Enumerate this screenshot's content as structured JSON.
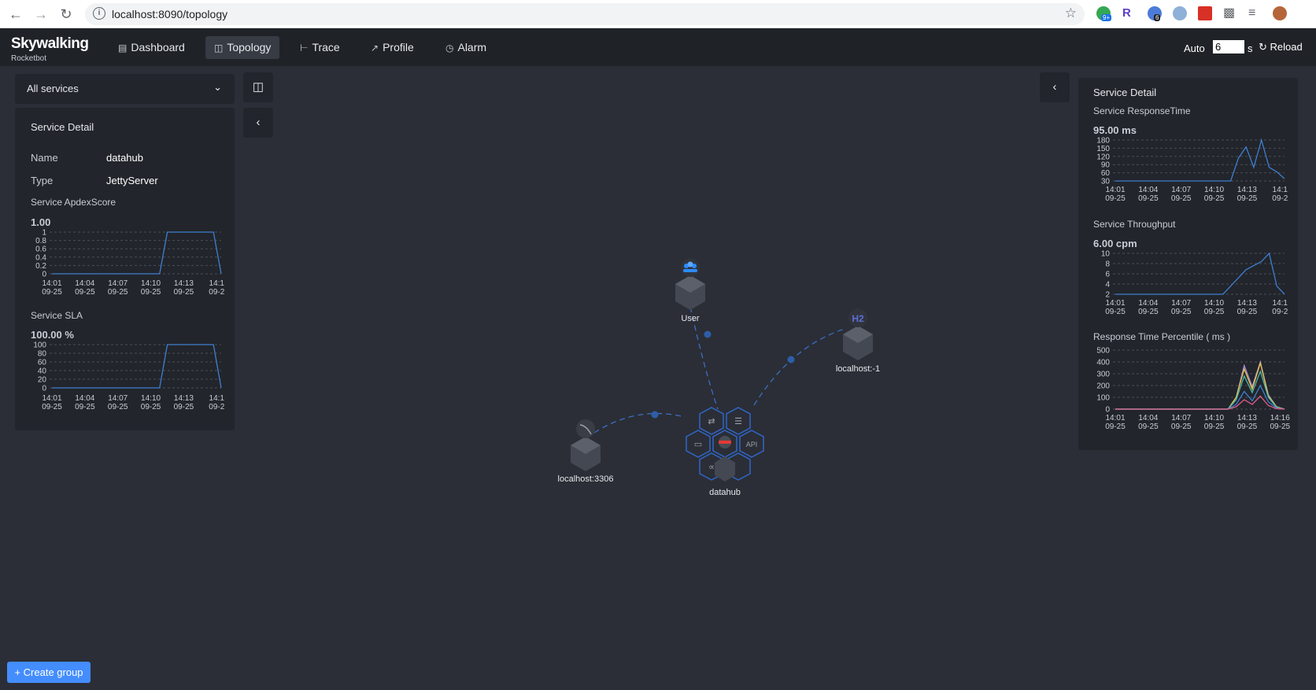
{
  "browser": {
    "url": "localhost:8090/topology",
    "extension_badges": [
      "9+",
      "R",
      "6"
    ]
  },
  "header": {
    "logo": "Skywalking",
    "logo_sub": "Rocketbot",
    "nav": [
      {
        "label": "Dashboard",
        "icon": "dashboard-icon"
      },
      {
        "label": "Topology",
        "icon": "topology-icon",
        "active": true
      },
      {
        "label": "Trace",
        "icon": "trace-icon"
      },
      {
        "label": "Profile",
        "icon": "profile-icon"
      },
      {
        "label": "Alarm",
        "icon": "alarm-icon"
      }
    ],
    "auto_label": "Auto",
    "interval_value": "6",
    "interval_unit": "s",
    "reload_label": "Reload"
  },
  "left": {
    "service_select": "All services",
    "detail_title": "Service Detail",
    "name_key": "Name",
    "name_value": "datahub",
    "type_key": "Type",
    "type_value": "JettyServer",
    "apdex_label": "Service ApdexScore",
    "apdex_value": "1.00",
    "sla_label": "Service SLA",
    "sla_value": "100.00 %"
  },
  "right": {
    "detail_title": "Service Detail",
    "resp_label": "Service ResponseTime",
    "resp_value": "95.00 ms",
    "tput_label": "Service Throughput",
    "tput_value": "6.00 cpm",
    "percentile_label": "Response Time Percentile ( ms )"
  },
  "create_group_label": "Create group",
  "topology": {
    "nodes": [
      {
        "name": "User",
        "icon": "users-icon"
      },
      {
        "name": "localhost:-1",
        "icon": "h2-icon",
        "icon_text": "H2"
      },
      {
        "name": "localhost:3306",
        "icon": "mysql-icon"
      },
      {
        "name": "datahub",
        "icon": "service-cluster-icon"
      }
    ]
  },
  "chart_data": [
    {
      "type": "line",
      "title": "Service ApdexScore",
      "x_labels": [
        "14:01\n09-25",
        "14:04\n09-25",
        "14:07\n09-25",
        "14:10\n09-25",
        "14:13\n09-25",
        "14:1\n09-2"
      ],
      "yticks": [
        "1",
        "0.8",
        "0.6",
        "0.4",
        "0.2",
        "0"
      ],
      "ylim": [
        0,
        1
      ],
      "values": [
        0,
        0,
        0,
        0,
        0,
        0,
        0,
        0,
        0,
        0,
        0,
        0,
        0,
        0,
        0,
        1,
        1,
        1,
        1,
        1,
        1,
        1,
        0
      ],
      "color": "#3f7fd0"
    },
    {
      "type": "line",
      "title": "Service SLA",
      "x_labels": [
        "14:01\n09-25",
        "14:04\n09-25",
        "14:07\n09-25",
        "14:10\n09-25",
        "14:13\n09-25",
        "14:1\n09-2"
      ],
      "yticks": [
        "100",
        "80",
        "60",
        "40",
        "20",
        "0"
      ],
      "ylim": [
        0,
        100
      ],
      "values": [
        0,
        0,
        0,
        0,
        0,
        0,
        0,
        0,
        0,
        0,
        0,
        0,
        0,
        0,
        0,
        100,
        100,
        100,
        100,
        100,
        100,
        100,
        0
      ],
      "color": "#3f7fd0"
    },
    {
      "type": "line",
      "title": "Service ResponseTime",
      "x_labels": [
        "14:01\n09-25",
        "14:04\n09-25",
        "14:07\n09-25",
        "14:10\n09-25",
        "14:13\n09-25",
        "14:1\n09-2"
      ],
      "yticks": [
        "180",
        "150",
        "120",
        "90",
        "60",
        "30"
      ],
      "ylim": [
        0,
        180
      ],
      "values": [
        0,
        0,
        0,
        0,
        0,
        0,
        0,
        0,
        0,
        0,
        0,
        0,
        0,
        0,
        0,
        0,
        100,
        150,
        60,
        180,
        60,
        40,
        10
      ],
      "color": "#3f7fd0"
    },
    {
      "type": "line",
      "title": "Service Throughput",
      "x_labels": [
        "14:01\n09-25",
        "14:04\n09-25",
        "14:07\n09-25",
        "14:10\n09-25",
        "14:13\n09-25",
        "14:1\n09-2"
      ],
      "yticks": [
        "10",
        "8",
        "6",
        "4",
        "2"
      ],
      "ylim": [
        0,
        10
      ],
      "values": [
        0,
        0,
        0,
        0,
        0,
        0,
        0,
        0,
        0,
        0,
        0,
        0,
        0,
        0,
        0,
        2,
        4,
        6,
        7,
        8,
        10,
        2,
        0
      ],
      "color": "#3f7fd0"
    },
    {
      "type": "line",
      "title": "Response Time Percentile ( ms )",
      "x_labels": [
        "14:01\n09-25",
        "14:04\n09-25",
        "14:07\n09-25",
        "14:10\n09-25",
        "14:13\n09-25",
        "14:16\n09-25"
      ],
      "yticks": [
        "500",
        "400",
        "300",
        "200",
        "100",
        "0"
      ],
      "ylim": [
        0,
        500
      ],
      "series": [
        {
          "values": [
            0,
            0,
            0,
            0,
            0,
            0,
            0,
            0,
            0,
            0,
            0,
            0,
            0,
            0,
            0,
            100,
            370,
            190,
            400,
            120,
            20,
            0
          ],
          "color": "#a78bdb"
        },
        {
          "values": [
            0,
            0,
            0,
            0,
            0,
            0,
            0,
            0,
            0,
            0,
            0,
            0,
            0,
            0,
            0,
            100,
            340,
            170,
            390,
            110,
            20,
            0
          ],
          "color": "#e8c24a"
        },
        {
          "values": [
            0,
            0,
            0,
            0,
            0,
            0,
            0,
            0,
            0,
            0,
            0,
            0,
            0,
            0,
            0,
            80,
            280,
            140,
            320,
            100,
            15,
            0
          ],
          "color": "#4bb8a9"
        },
        {
          "values": [
            0,
            0,
            0,
            0,
            0,
            0,
            0,
            0,
            0,
            0,
            0,
            0,
            0,
            0,
            0,
            40,
            150,
            70,
            200,
            60,
            10,
            0
          ],
          "color": "#3f7fd0"
        },
        {
          "values": [
            0,
            0,
            0,
            0,
            0,
            0,
            0,
            0,
            0,
            0,
            0,
            0,
            0,
            0,
            0,
            20,
            80,
            40,
            110,
            30,
            5,
            0
          ],
          "color": "#e05d8a"
        }
      ]
    }
  ]
}
